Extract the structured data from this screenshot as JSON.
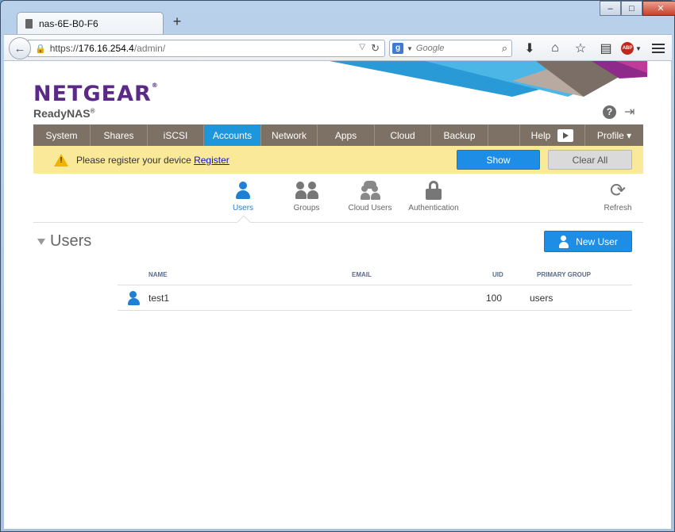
{
  "browser": {
    "tab_title": "nas-6E-B0-F6",
    "new_tab": "+",
    "url_scheme": "https://",
    "url_host": "176.16.254.4",
    "url_path": "/admin/",
    "search_placeholder": "Google",
    "search_engine_letter": "g",
    "window_buttons": {
      "minimize": "–",
      "maximize": "□",
      "close": "✕"
    }
  },
  "brand": {
    "logo": "NETGEAR",
    "product": "ReadyNAS",
    "registered": "®"
  },
  "main_nav": [
    {
      "label": "System"
    },
    {
      "label": "Shares"
    },
    {
      "label": "iSCSI"
    },
    {
      "label": "Accounts"
    },
    {
      "label": "Network"
    },
    {
      "label": "Apps"
    },
    {
      "label": "Cloud"
    },
    {
      "label": "Backup"
    },
    {
      "label": ""
    },
    {
      "label": "Help"
    },
    {
      "label": "Profile ▾"
    }
  ],
  "register_bar": {
    "message": "Please register your device",
    "link": "Register",
    "show_button": "Show",
    "clear_button": "Clear All"
  },
  "sub_nav": {
    "users": "Users",
    "groups": "Groups",
    "cloud_users": "Cloud Users",
    "authentication": "Authentication",
    "refresh": "Refresh"
  },
  "section": {
    "title": "Users",
    "new_user_button": "New User"
  },
  "table": {
    "headers": {
      "name": "NAME",
      "email": "EMAIL",
      "uid": "UID",
      "primary_group": "PRIMARY GROUP"
    },
    "rows": [
      {
        "name": "test1",
        "email": "",
        "uid": "100",
        "primary_group": "users"
      }
    ]
  },
  "colors": {
    "accent": "#1e96dc",
    "nav_bg": "#7d7166",
    "brand": "#5b2a86",
    "warning_bg": "#fbe99a"
  }
}
